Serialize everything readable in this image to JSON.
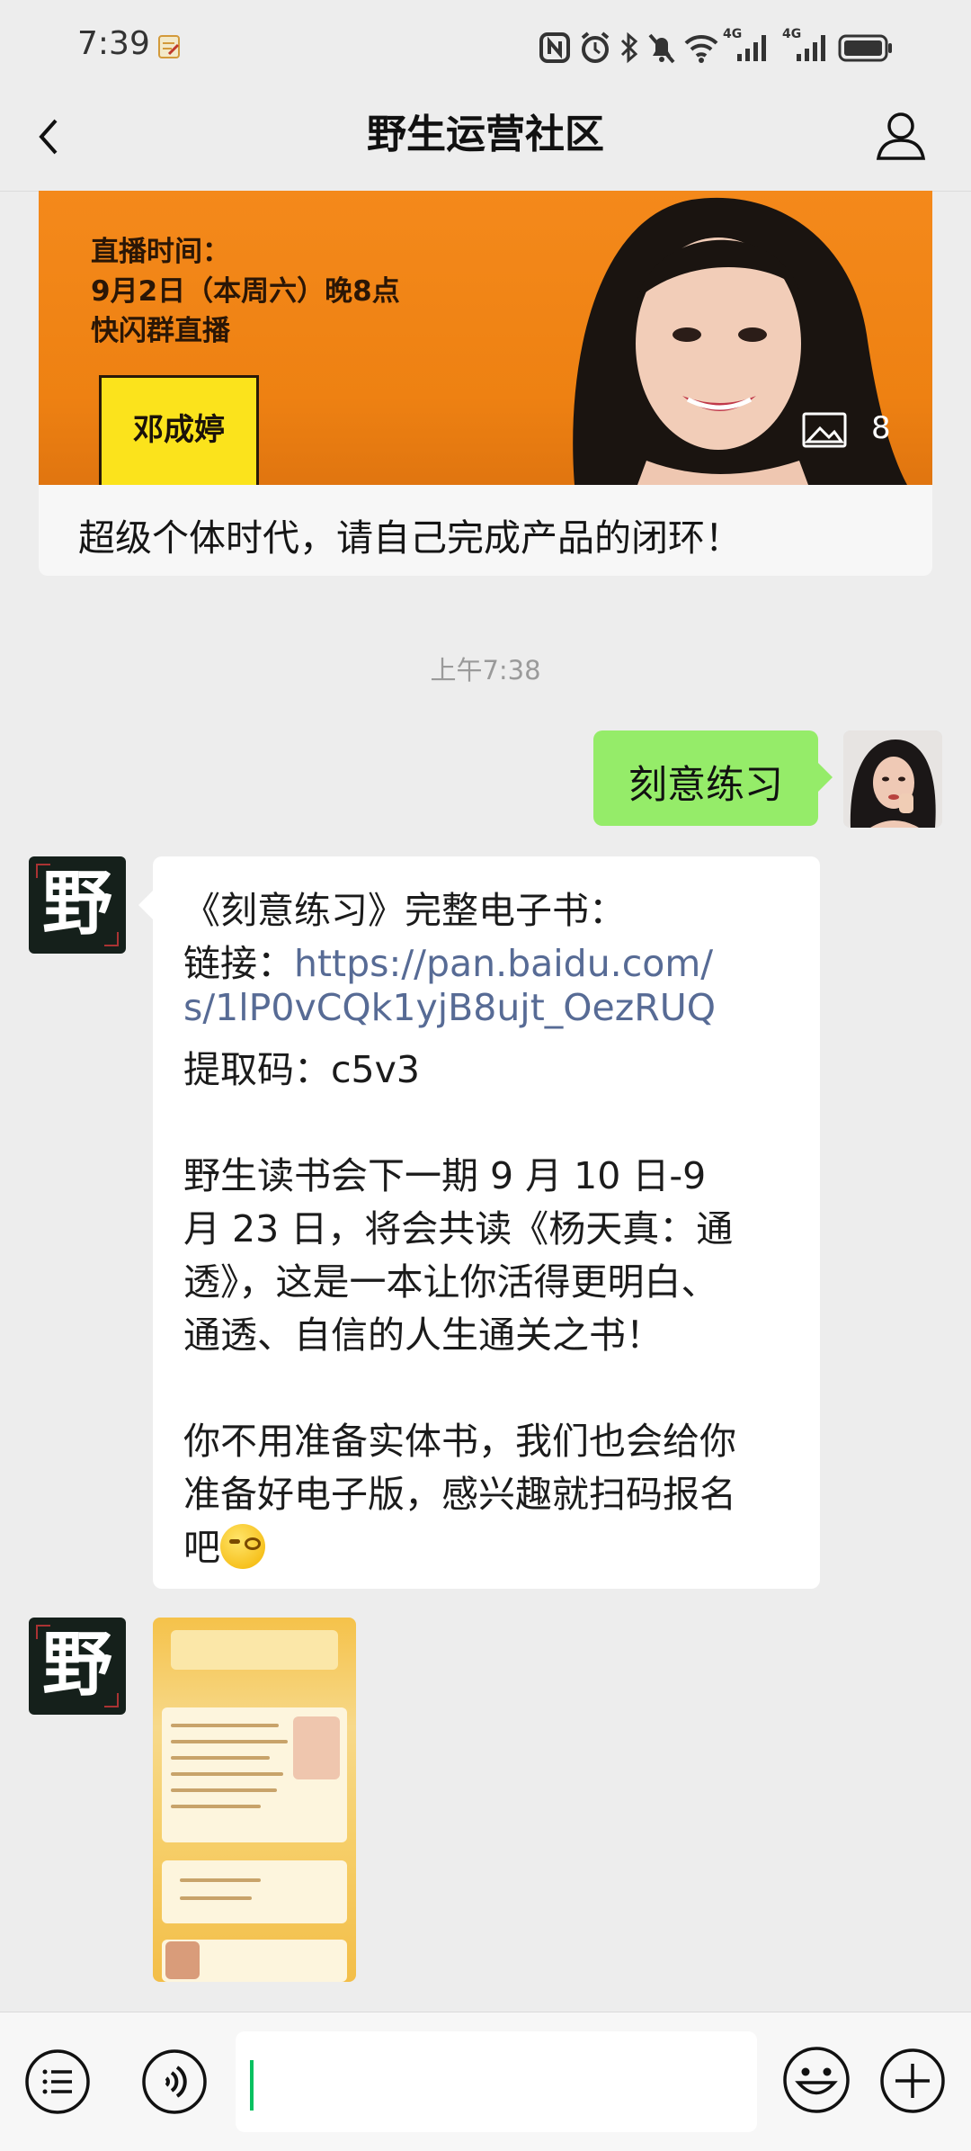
{
  "status_bar": {
    "time": "7:39",
    "network_labels": [
      "4G",
      "4G"
    ]
  },
  "nav": {
    "title": "野生运营社区"
  },
  "link_card": {
    "banner_lines": [
      "直播时间：",
      "9月2日（本周六）晚8点",
      "快闪群直播"
    ],
    "speaker_name": "邓成婷",
    "image_count": "8",
    "title": "超级个体时代，请自己完成产品的闭环！"
  },
  "timestamp": "上午7:38",
  "outgoing_message": {
    "text": "刻意练习"
  },
  "incoming_message": {
    "avatar_char": "野",
    "lines": [
      {
        "text": "《刻意练习》完整电子书："
      },
      {
        "prefix": "链接：",
        "link": "https://pan.baidu.com/"
      },
      {
        "link": "s/1lP0vCQk1yjB8ujt_OezRUQ"
      },
      {
        "text": "提取码：c5v3"
      },
      {
        "text": "野生读书会下一期 9 月 10 日-9"
      },
      {
        "text": "月 23 日，将会共读《杨天真：通"
      },
      {
        "text": "透》，这是一本让你活得更明白、"
      },
      {
        "text": "通透、自信的人生通关之书！"
      },
      {
        "text": "你不用准备实体书，我们也会给你"
      },
      {
        "text": "准备好电子版，感兴趣就扫码报名"
      },
      {
        "text": "吧"
      }
    ],
    "emoji": "smirk-emoji"
  },
  "image_message": {
    "avatar_char": "野"
  },
  "input_bar": {
    "value": "",
    "icons": [
      "menu-list-icon",
      "voice-icon",
      "emoji-icon",
      "plus-icon"
    ]
  },
  "colors": {
    "background": "#ededed",
    "outgoing_bubble": "#95ec69",
    "link": "#576b95",
    "caret": "#07c160",
    "banner": "#f4891b"
  }
}
